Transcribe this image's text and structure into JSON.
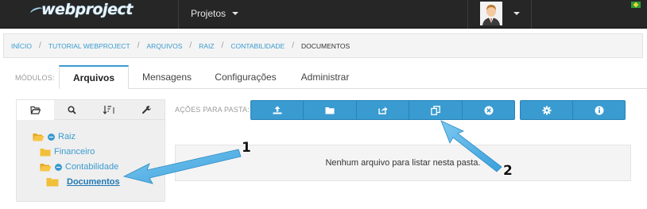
{
  "app": {
    "logo_text": "webproject"
  },
  "topbar": {
    "projects_label": "Projetos"
  },
  "breadcrumb": {
    "items": [
      "INÍCIO",
      "TUTORIAL WEBPROJECT",
      "ARQUIVOS",
      "RAIZ",
      "CONTABILIDADE"
    ],
    "current": "DOCUMENTOS",
    "separator": "/"
  },
  "modules": {
    "label": "MÓDULOS:",
    "tabs": [
      {
        "label": "Arquivos",
        "active": true
      },
      {
        "label": "Mensagens",
        "active": false
      },
      {
        "label": "Configurações",
        "active": false
      },
      {
        "label": "Administrar",
        "active": false
      }
    ]
  },
  "left_panel": {
    "tool_tabs": [
      "folder-open-icon",
      "search-icon",
      "sort-icon",
      "wrench-icon"
    ],
    "tree": [
      {
        "label": "Raiz",
        "icon": "folder-open-icon",
        "expanded": true
      },
      {
        "label": "Financeiro",
        "icon": "folder-icon"
      },
      {
        "label": "Contabilidade",
        "icon": "folder-open-icon",
        "expanded": true
      },
      {
        "label": "Documentos",
        "icon": "folder-icon",
        "selected": true
      }
    ]
  },
  "actions": {
    "label": "AÇÕES PARA PASTA:",
    "group1": [
      "upload-icon",
      "folder-icon",
      "share-icon",
      "copy-icon",
      "close-circle-icon"
    ],
    "group2": [
      "gear-icon",
      "info-icon"
    ]
  },
  "empty_message": "Nenhum arquivo para listar nesta pasta.",
  "annotations": {
    "callout_1": "1",
    "callout_2": "2"
  },
  "colors": {
    "accent": "#3a9bd1",
    "topbar": "#262626",
    "folder": "#f2bf3a",
    "arrow": "#5bb5e8"
  }
}
